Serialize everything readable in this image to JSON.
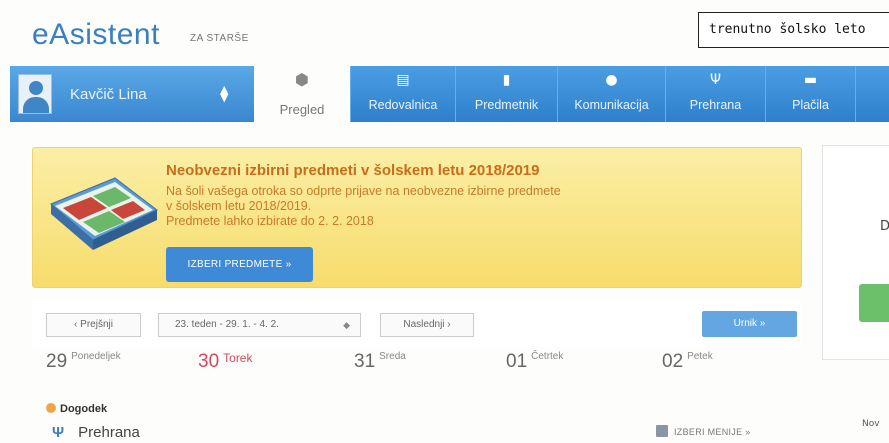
{
  "header": {
    "logo": "eAsistent",
    "logo_sub": "ZA STARŠE",
    "school_year_value": "trenutno šolsko leto"
  },
  "user": {
    "name": "Kavčič Lina"
  },
  "nav": {
    "active": {
      "label": "Pregled",
      "icon": "cube-icon"
    },
    "tabs": [
      {
        "label": "Redovalnica",
        "icon": "grades-icon"
      },
      {
        "label": "Predmetnik",
        "icon": "book-icon"
      },
      {
        "label": "Komunikacija",
        "icon": "chat-icon"
      },
      {
        "label": "Prehrana",
        "icon": "food-icon"
      },
      {
        "label": "Plačila",
        "icon": "wallet-icon"
      }
    ]
  },
  "banner": {
    "title": "Neobvezni izbirni predmeti v šolskem letu 2018/2019",
    "line1": "Na šoli vašega otroka so odprte prijave na neobvezne izbirne predmete",
    "line2": "v šolskem letu 2018/2019.",
    "line3": "Predmete lahko izbirate do 2. 2. 2018",
    "button": "IZBERI PREDMETE »"
  },
  "side": {
    "letter": "D",
    "nov": "Nov"
  },
  "week": {
    "prev": "‹  Prejšnji",
    "range": "23. teden - 29. 1. - 4. 2.",
    "next": "Naslednji  ›",
    "urnik": "Urnik »"
  },
  "days": [
    {
      "num": "29",
      "name": "Ponedeljek"
    },
    {
      "num": "30",
      "name": "Torek"
    },
    {
      "num": "31",
      "name": "Sreda"
    },
    {
      "num": "01",
      "name": "Četrtek"
    },
    {
      "num": "02",
      "name": "Petek"
    }
  ],
  "event": {
    "label": "Dogodek"
  },
  "food": {
    "label": "Prehrana",
    "menu_link": "IZBERI MENIJE »"
  },
  "colors": {
    "brand_blue": "#3a7fc0",
    "banner_title": "#c86d1c",
    "today": "#d04b5e"
  }
}
